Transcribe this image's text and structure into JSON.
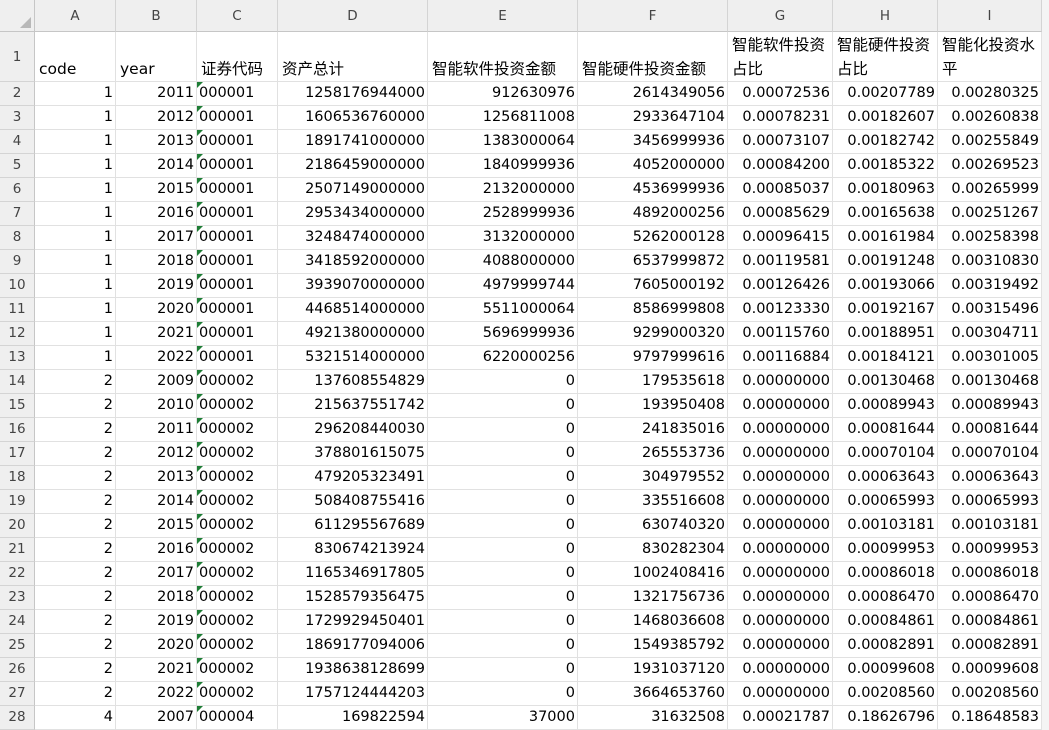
{
  "columns": [
    "A",
    "B",
    "C",
    "D",
    "E",
    "F",
    "G",
    "H",
    "I"
  ],
  "header_row": {
    "row_label": "1",
    "cells": [
      "code",
      "year",
      "证券代码",
      "资产总计",
      "智能软件投资金额",
      "智能硬件投资金额",
      "智能软件投资占比",
      "智能硬件投资占比",
      "智能化投资水平"
    ]
  },
  "rows": [
    {
      "row": "2",
      "code": "1",
      "year": "2011",
      "stock": "000001",
      "assets": "1258176944000",
      "soft_amt": "912630976",
      "hard_amt": "2614349056",
      "soft_ratio": "0.00072536",
      "hard_ratio": "0.00207789",
      "level": "0.00280325"
    },
    {
      "row": "3",
      "code": "1",
      "year": "2012",
      "stock": "000001",
      "assets": "1606536760000",
      "soft_amt": "1256811008",
      "hard_amt": "2933647104",
      "soft_ratio": "0.00078231",
      "hard_ratio": "0.00182607",
      "level": "0.00260838"
    },
    {
      "row": "4",
      "code": "1",
      "year": "2013",
      "stock": "000001",
      "assets": "1891741000000",
      "soft_amt": "1383000064",
      "hard_amt": "3456999936",
      "soft_ratio": "0.00073107",
      "hard_ratio": "0.00182742",
      "level": "0.00255849"
    },
    {
      "row": "5",
      "code": "1",
      "year": "2014",
      "stock": "000001",
      "assets": "2186459000000",
      "soft_amt": "1840999936",
      "hard_amt": "4052000000",
      "soft_ratio": "0.00084200",
      "hard_ratio": "0.00185322",
      "level": "0.00269523"
    },
    {
      "row": "6",
      "code": "1",
      "year": "2015",
      "stock": "000001",
      "assets": "2507149000000",
      "soft_amt": "2132000000",
      "hard_amt": "4536999936",
      "soft_ratio": "0.00085037",
      "hard_ratio": "0.00180963",
      "level": "0.00265999"
    },
    {
      "row": "7",
      "code": "1",
      "year": "2016",
      "stock": "000001",
      "assets": "2953434000000",
      "soft_amt": "2528999936",
      "hard_amt": "4892000256",
      "soft_ratio": "0.00085629",
      "hard_ratio": "0.00165638",
      "level": "0.00251267"
    },
    {
      "row": "8",
      "code": "1",
      "year": "2017",
      "stock": "000001",
      "assets": "3248474000000",
      "soft_amt": "3132000000",
      "hard_amt": "5262000128",
      "soft_ratio": "0.00096415",
      "hard_ratio": "0.00161984",
      "level": "0.00258398"
    },
    {
      "row": "9",
      "code": "1",
      "year": "2018",
      "stock": "000001",
      "assets": "3418592000000",
      "soft_amt": "4088000000",
      "hard_amt": "6537999872",
      "soft_ratio": "0.00119581",
      "hard_ratio": "0.00191248",
      "level": "0.00310830"
    },
    {
      "row": "10",
      "code": "1",
      "year": "2019",
      "stock": "000001",
      "assets": "3939070000000",
      "soft_amt": "4979999744",
      "hard_amt": "7605000192",
      "soft_ratio": "0.00126426",
      "hard_ratio": "0.00193066",
      "level": "0.00319492"
    },
    {
      "row": "11",
      "code": "1",
      "year": "2020",
      "stock": "000001",
      "assets": "4468514000000",
      "soft_amt": "5511000064",
      "hard_amt": "8586999808",
      "soft_ratio": "0.00123330",
      "hard_ratio": "0.00192167",
      "level": "0.00315496"
    },
    {
      "row": "12",
      "code": "1",
      "year": "2021",
      "stock": "000001",
      "assets": "4921380000000",
      "soft_amt": "5696999936",
      "hard_amt": "9299000320",
      "soft_ratio": "0.00115760",
      "hard_ratio": "0.00188951",
      "level": "0.00304711"
    },
    {
      "row": "13",
      "code": "1",
      "year": "2022",
      "stock": "000001",
      "assets": "5321514000000",
      "soft_amt": "6220000256",
      "hard_amt": "9797999616",
      "soft_ratio": "0.00116884",
      "hard_ratio": "0.00184121",
      "level": "0.00301005"
    },
    {
      "row": "14",
      "code": "2",
      "year": "2009",
      "stock": "000002",
      "assets": "137608554829",
      "soft_amt": "0",
      "hard_amt": "179535618",
      "soft_ratio": "0.00000000",
      "hard_ratio": "0.00130468",
      "level": "0.00130468"
    },
    {
      "row": "15",
      "code": "2",
      "year": "2010",
      "stock": "000002",
      "assets": "215637551742",
      "soft_amt": "0",
      "hard_amt": "193950408",
      "soft_ratio": "0.00000000",
      "hard_ratio": "0.00089943",
      "level": "0.00089943"
    },
    {
      "row": "16",
      "code": "2",
      "year": "2011",
      "stock": "000002",
      "assets": "296208440030",
      "soft_amt": "0",
      "hard_amt": "241835016",
      "soft_ratio": "0.00000000",
      "hard_ratio": "0.00081644",
      "level": "0.00081644"
    },
    {
      "row": "17",
      "code": "2",
      "year": "2012",
      "stock": "000002",
      "assets": "378801615075",
      "soft_amt": "0",
      "hard_amt": "265553736",
      "soft_ratio": "0.00000000",
      "hard_ratio": "0.00070104",
      "level": "0.00070104"
    },
    {
      "row": "18",
      "code": "2",
      "year": "2013",
      "stock": "000002",
      "assets": "479205323491",
      "soft_amt": "0",
      "hard_amt": "304979552",
      "soft_ratio": "0.00000000",
      "hard_ratio": "0.00063643",
      "level": "0.00063643"
    },
    {
      "row": "19",
      "code": "2",
      "year": "2014",
      "stock": "000002",
      "assets": "508408755416",
      "soft_amt": "0",
      "hard_amt": "335516608",
      "soft_ratio": "0.00000000",
      "hard_ratio": "0.00065993",
      "level": "0.00065993"
    },
    {
      "row": "20",
      "code": "2",
      "year": "2015",
      "stock": "000002",
      "assets": "611295567689",
      "soft_amt": "0",
      "hard_amt": "630740320",
      "soft_ratio": "0.00000000",
      "hard_ratio": "0.00103181",
      "level": "0.00103181"
    },
    {
      "row": "21",
      "code": "2",
      "year": "2016",
      "stock": "000002",
      "assets": "830674213924",
      "soft_amt": "0",
      "hard_amt": "830282304",
      "soft_ratio": "0.00000000",
      "hard_ratio": "0.00099953",
      "level": "0.00099953"
    },
    {
      "row": "22",
      "code": "2",
      "year": "2017",
      "stock": "000002",
      "assets": "1165346917805",
      "soft_amt": "0",
      "hard_amt": "1002408416",
      "soft_ratio": "0.00000000",
      "hard_ratio": "0.00086018",
      "level": "0.00086018"
    },
    {
      "row": "23",
      "code": "2",
      "year": "2018",
      "stock": "000002",
      "assets": "1528579356475",
      "soft_amt": "0",
      "hard_amt": "1321756736",
      "soft_ratio": "0.00000000",
      "hard_ratio": "0.00086470",
      "level": "0.00086470"
    },
    {
      "row": "24",
      "code": "2",
      "year": "2019",
      "stock": "000002",
      "assets": "1729929450401",
      "soft_amt": "0",
      "hard_amt": "1468036608",
      "soft_ratio": "0.00000000",
      "hard_ratio": "0.00084861",
      "level": "0.00084861"
    },
    {
      "row": "25",
      "code": "2",
      "year": "2020",
      "stock": "000002",
      "assets": "1869177094006",
      "soft_amt": "0",
      "hard_amt": "1549385792",
      "soft_ratio": "0.00000000",
      "hard_ratio": "0.00082891",
      "level": "0.00082891"
    },
    {
      "row": "26",
      "code": "2",
      "year": "2021",
      "stock": "000002",
      "assets": "1938638128699",
      "soft_amt": "0",
      "hard_amt": "1931037120",
      "soft_ratio": "0.00000000",
      "hard_ratio": "0.00099608",
      "level": "0.00099608"
    },
    {
      "row": "27",
      "code": "2",
      "year": "2022",
      "stock": "000002",
      "assets": "1757124444203",
      "soft_amt": "0",
      "hard_amt": "3664653760",
      "soft_ratio": "0.00000000",
      "hard_ratio": "0.00208560",
      "level": "0.00208560"
    },
    {
      "row": "28",
      "code": "4",
      "year": "2007",
      "stock": "000004",
      "assets": "169822594",
      "soft_amt": "37000",
      "hard_amt": "31632508",
      "soft_ratio": "0.00021787",
      "hard_ratio": "0.18626796",
      "level": "0.18648583"
    }
  ],
  "colors": {
    "header_bg": "#efefef",
    "gridline": "#e1e1e1",
    "text_flag": "#1e7d35"
  }
}
